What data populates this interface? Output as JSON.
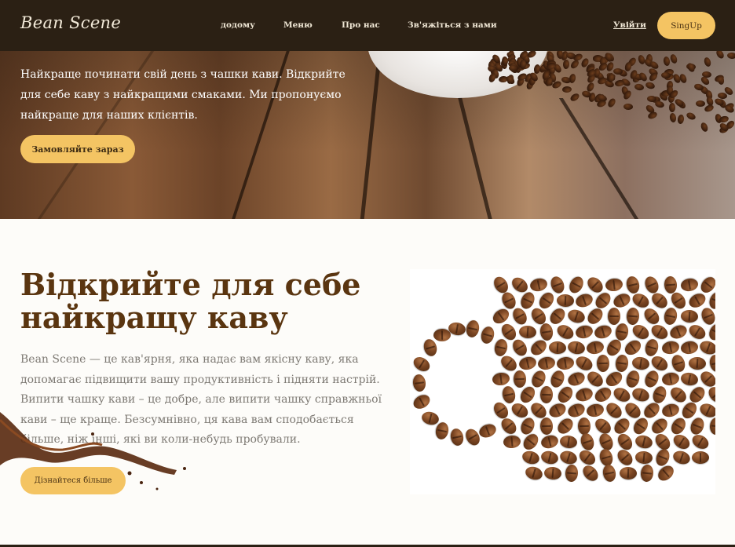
{
  "header": {
    "logo": "Bean Scene",
    "nav": {
      "home": "додому",
      "menu": "Меню",
      "about": "Про нас",
      "contact": "Зв'яжіться з нами"
    },
    "login_label": "Увійти",
    "signup_label": "SingUp"
  },
  "hero": {
    "text": "Найкраще починати свій день з чашки кави. Відкрийте для себе каву з найкращими смаками. Ми пропонуємо найкраще для наших клієнтів.",
    "order_button": "Замовляйте зараз"
  },
  "about": {
    "title": "Відкрийте для себе найкращу каву",
    "text": "Bean Scene — це кав'ярня, яка надає вам якісну каву, яка допомагає підвищити вашу продуктивність і підняти настрій. Випити чашку кави – це добре, але випити чашку справжньої кави – ще краще. Безсумнівно, ця кава вам сподобається більше, ніж інші, які ви коли-небудь пробували.",
    "learn_more_button": "Дізнайтеся більше"
  },
  "colors": {
    "header_bg": "#2b2014",
    "accent": "#f4c463",
    "title": "#5a3510"
  }
}
